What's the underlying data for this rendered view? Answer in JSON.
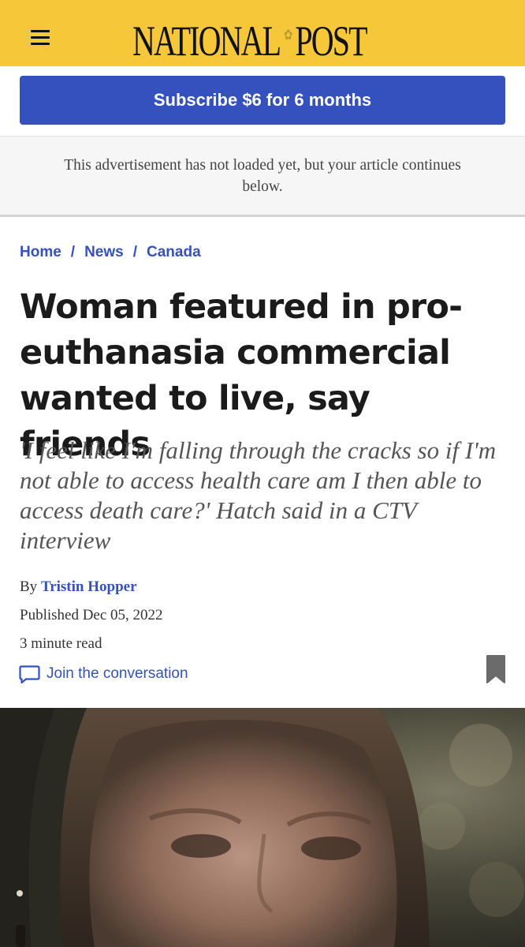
{
  "header": {
    "brand_part1": "NATIONAL",
    "brand_part2": "POST",
    "brand_color": "#f6c839",
    "menu_icon": "hamburger-menu-icon"
  },
  "subscribe": {
    "label": "Subscribe $6 for 6 months",
    "color": "#3451bd"
  },
  "ad_notice": {
    "text": "This advertisement has not loaded yet, but your article continues below."
  },
  "breadcrumb": {
    "items": [
      "Home",
      "News",
      "Canada"
    ],
    "separator": "/"
  },
  "article": {
    "headline": "Woman featured in pro-euthanasia commercial wanted to live, say friends",
    "deck": "'I feel like I'm falling through the cracks so if I'm not able to access health care am I then able to access death care?' Hatch said in a CTV interview",
    "byline_prefix": "By",
    "author": "Tristin Hopper",
    "published": "Published Dec 05, 2022",
    "read_time": "3 minute read",
    "conversation_label": "Join the conversation",
    "conversation_icon": "chat-bubble-icon",
    "bookmark_icon": "bookmark-icon"
  },
  "hero_image": {
    "description": "close-up-portrait-photo"
  }
}
